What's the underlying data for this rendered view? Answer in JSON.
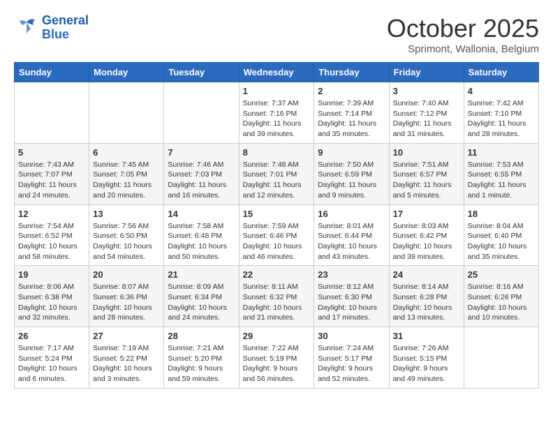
{
  "header": {
    "logo_line1": "General",
    "logo_line2": "Blue",
    "month_title": "October 2025",
    "subtitle": "Sprimont, Wallonia, Belgium"
  },
  "weekdays": [
    "Sunday",
    "Monday",
    "Tuesday",
    "Wednesday",
    "Thursday",
    "Friday",
    "Saturday"
  ],
  "weeks": [
    [
      {
        "day": "",
        "info": ""
      },
      {
        "day": "",
        "info": ""
      },
      {
        "day": "",
        "info": ""
      },
      {
        "day": "1",
        "info": "Sunrise: 7:37 AM\nSunset: 7:16 PM\nDaylight: 11 hours\nand 39 minutes."
      },
      {
        "day": "2",
        "info": "Sunrise: 7:39 AM\nSunset: 7:14 PM\nDaylight: 11 hours\nand 35 minutes."
      },
      {
        "day": "3",
        "info": "Sunrise: 7:40 AM\nSunset: 7:12 PM\nDaylight: 11 hours\nand 31 minutes."
      },
      {
        "day": "4",
        "info": "Sunrise: 7:42 AM\nSunset: 7:10 PM\nDaylight: 11 hours\nand 28 minutes."
      }
    ],
    [
      {
        "day": "5",
        "info": "Sunrise: 7:43 AM\nSunset: 7:07 PM\nDaylight: 11 hours\nand 24 minutes."
      },
      {
        "day": "6",
        "info": "Sunrise: 7:45 AM\nSunset: 7:05 PM\nDaylight: 11 hours\nand 20 minutes."
      },
      {
        "day": "7",
        "info": "Sunrise: 7:46 AM\nSunset: 7:03 PM\nDaylight: 11 hours\nand 16 minutes."
      },
      {
        "day": "8",
        "info": "Sunrise: 7:48 AM\nSunset: 7:01 PM\nDaylight: 11 hours\nand 12 minutes."
      },
      {
        "day": "9",
        "info": "Sunrise: 7:50 AM\nSunset: 6:59 PM\nDaylight: 11 hours\nand 9 minutes."
      },
      {
        "day": "10",
        "info": "Sunrise: 7:51 AM\nSunset: 6:57 PM\nDaylight: 11 hours\nand 5 minutes."
      },
      {
        "day": "11",
        "info": "Sunrise: 7:53 AM\nSunset: 6:55 PM\nDaylight: 11 hours\nand 1 minute."
      }
    ],
    [
      {
        "day": "12",
        "info": "Sunrise: 7:54 AM\nSunset: 6:52 PM\nDaylight: 10 hours\nand 58 minutes."
      },
      {
        "day": "13",
        "info": "Sunrise: 7:56 AM\nSunset: 6:50 PM\nDaylight: 10 hours\nand 54 minutes."
      },
      {
        "day": "14",
        "info": "Sunrise: 7:58 AM\nSunset: 6:48 PM\nDaylight: 10 hours\nand 50 minutes."
      },
      {
        "day": "15",
        "info": "Sunrise: 7:59 AM\nSunset: 6:46 PM\nDaylight: 10 hours\nand 46 minutes."
      },
      {
        "day": "16",
        "info": "Sunrise: 8:01 AM\nSunset: 6:44 PM\nDaylight: 10 hours\nand 43 minutes."
      },
      {
        "day": "17",
        "info": "Sunrise: 8:03 AM\nSunset: 6:42 PM\nDaylight: 10 hours\nand 39 minutes."
      },
      {
        "day": "18",
        "info": "Sunrise: 8:04 AM\nSunset: 6:40 PM\nDaylight: 10 hours\nand 35 minutes."
      }
    ],
    [
      {
        "day": "19",
        "info": "Sunrise: 8:06 AM\nSunset: 6:38 PM\nDaylight: 10 hours\nand 32 minutes."
      },
      {
        "day": "20",
        "info": "Sunrise: 8:07 AM\nSunset: 6:36 PM\nDaylight: 10 hours\nand 28 minutes."
      },
      {
        "day": "21",
        "info": "Sunrise: 8:09 AM\nSunset: 6:34 PM\nDaylight: 10 hours\nand 24 minutes."
      },
      {
        "day": "22",
        "info": "Sunrise: 8:11 AM\nSunset: 6:32 PM\nDaylight: 10 hours\nand 21 minutes."
      },
      {
        "day": "23",
        "info": "Sunrise: 8:12 AM\nSunset: 6:30 PM\nDaylight: 10 hours\nand 17 minutes."
      },
      {
        "day": "24",
        "info": "Sunrise: 8:14 AM\nSunset: 6:28 PM\nDaylight: 10 hours\nand 13 minutes."
      },
      {
        "day": "25",
        "info": "Sunrise: 8:16 AM\nSunset: 6:26 PM\nDaylight: 10 hours\nand 10 minutes."
      }
    ],
    [
      {
        "day": "26",
        "info": "Sunrise: 7:17 AM\nSunset: 5:24 PM\nDaylight: 10 hours\nand 6 minutes."
      },
      {
        "day": "27",
        "info": "Sunrise: 7:19 AM\nSunset: 5:22 PM\nDaylight: 10 hours\nand 3 minutes."
      },
      {
        "day": "28",
        "info": "Sunrise: 7:21 AM\nSunset: 5:20 PM\nDaylight: 9 hours\nand 59 minutes."
      },
      {
        "day": "29",
        "info": "Sunrise: 7:22 AM\nSunset: 5:19 PM\nDaylight: 9 hours\nand 56 minutes."
      },
      {
        "day": "30",
        "info": "Sunrise: 7:24 AM\nSunset: 5:17 PM\nDaylight: 9 hours\nand 52 minutes."
      },
      {
        "day": "31",
        "info": "Sunrise: 7:26 AM\nSunset: 5:15 PM\nDaylight: 9 hours\nand 49 minutes."
      },
      {
        "day": "",
        "info": ""
      }
    ]
  ]
}
